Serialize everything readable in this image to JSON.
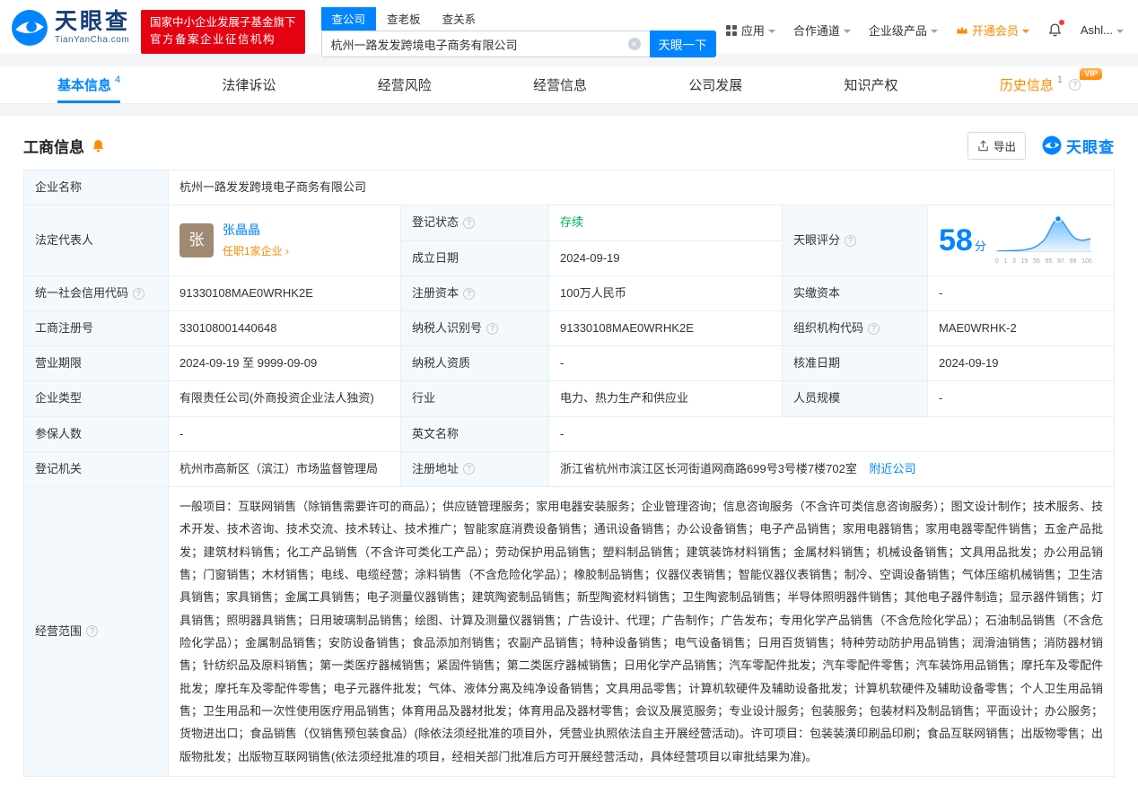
{
  "header": {
    "logo": {
      "title": "天眼查",
      "subtitle": "TianYanCha.com"
    },
    "badge": {
      "line1": "国家中小企业发展子基金旗下",
      "line2": "官方备案企业征信机构"
    },
    "search": {
      "tabs": [
        {
          "label": "查公司"
        },
        {
          "label": "查老板"
        },
        {
          "label": "查关系"
        }
      ],
      "value": "杭州一路发发跨境电子商务有限公司",
      "button": "天眼一下"
    },
    "nav": {
      "apps": "应用",
      "cooperation": "合作通道",
      "enterprise": "企业级产品",
      "vip": "开通会员",
      "user": "Ashl..."
    }
  },
  "tabs": {
    "items": [
      {
        "label": "基本信息",
        "count": "4"
      },
      {
        "label": "法律诉讼"
      },
      {
        "label": "经营风险"
      },
      {
        "label": "经营信息"
      },
      {
        "label": "公司发展"
      },
      {
        "label": "知识产权"
      },
      {
        "label": "历史信息",
        "count": "1",
        "badge": "VIP"
      }
    ]
  },
  "section": {
    "title": "工商信息",
    "export_label": "导出",
    "brand": "天眼查"
  },
  "company": {
    "name_label": "企业名称",
    "name": "杭州一路发发跨境电子商务有限公司",
    "legal_label": "法定代表人",
    "legal_avatar": "张",
    "legal_name": "张晶晶",
    "legal_roles": "任职1家企业 ›",
    "status_label": "登记状态",
    "status": "存续",
    "est_label": "成立日期",
    "est_date": "2024-09-19",
    "score_label": "天眼评分",
    "score": "58",
    "score_unit": "分",
    "credit_label": "统一社会信用代码",
    "credit_code": "91330108MAE0WRHK2E",
    "capital_label": "注册资本",
    "capital": "100万人民币",
    "paid_label": "实缴资本",
    "paid": "-",
    "regno_label": "工商注册号",
    "regno": "330108001440648",
    "taxno_label": "纳税人识别号",
    "taxno": "91330108MAE0WRHK2E",
    "orgcode_label": "组织机构代码",
    "orgcode": "MAE0WRHK-2",
    "term_label": "营业期限",
    "term": "2024-09-19 至 9999-09-09",
    "taxq_label": "纳税人资质",
    "taxq": "-",
    "approve_label": "核准日期",
    "approve_date": "2024-09-19",
    "type_label": "企业类型",
    "type": "有限责任公司(外商投资企业法人独资)",
    "industry_label": "行业",
    "industry": "电力、热力生产和供应业",
    "staff_label": "人员规模",
    "staff": "-",
    "insured_label": "参保人数",
    "insured": "-",
    "en_label": "英文名称",
    "en_name": "-",
    "authority_label": "登记机关",
    "authority": "杭州市高新区（滨江）市场监督管理局",
    "address_label": "注册地址",
    "address": "浙江省杭州市滨江区长河街道网商路699号3号楼7楼702室",
    "address_link": "附近公司",
    "scope_label": "经营范围",
    "scope": "一般项目：互联网销售（除销售需要许可的商品）；供应链管理服务；家用电器安装服务；企业管理咨询；信息咨询服务（不含许可类信息咨询服务）；图文设计制作；技术服务、技术开发、技术咨询、技术交流、技术转让、技术推广；智能家庭消费设备销售；通讯设备销售；办公设备销售；电子产品销售；家用电器销售；家用电器零配件销售；五金产品批发；建筑材料销售；化工产品销售（不含许可类化工产品）；劳动保护用品销售；塑料制品销售；建筑装饰材料销售；金属材料销售；机械设备销售；文具用品批发；办公用品销售；门窗销售；木材销售；电线、电缆经营；涂料销售（不含危险化学品）；橡胶制品销售；仪器仪表销售；智能仪器仪表销售；制冷、空调设备销售；气体压缩机械销售；卫生洁具销售；家具销售；金属工具销售；电子测量仪器销售；建筑陶瓷制品销售；新型陶瓷材料销售；卫生陶瓷制品销售；半导体照明器件销售；其他电子器件制造；显示器件销售；灯具销售；照明器具销售；日用玻璃制品销售；绘图、计算及测量仪器销售；广告设计、代理；广告制作；广告发布；专用化学产品销售（不含危险化学品）；石油制品销售（不含危险化学品）；金属制品销售；安防设备销售；食品添加剂销售；农副产品销售；特种设备销售；电气设备销售；日用百货销售；特种劳动防护用品销售；润滑油销售；消防器材销售；针纺织品及原料销售；第一类医疗器械销售；紧固件销售；第二类医疗器械销售；日用化学产品销售；汽车零配件批发；汽车零配件零售；汽车装饰用品销售；摩托车及零配件批发；摩托车及零配件零售；电子元器件批发；气体、液体分离及纯净设备销售；文具用品零售；计算机软硬件及辅助设备批发；计算机软硬件及辅助设备零售；个人卫生用品销售；卫生用品和一次性使用医疗用品销售；体育用品及器材批发；体育用品及器材零售；会议及展览服务；专业设计服务；包装服务；包装材料及制品销售；平面设计；办公服务；货物进出口；食品销售（仅销售预包装食品）(除依法须经批准的项目外，凭营业执照依法自主开展经营活动)。许可项目：包装装潢印刷品印刷；食品互联网销售；出版物零售；出版物批发；出版物互联网销售(依法须经批准的项目，经相关部门批准后方可开展经营活动，具体经营项目以审批结果为准)。"
  },
  "score_chart": {
    "ticks": [
      "0",
      "1",
      "3",
      "15",
      "55",
      "65",
      "97",
      "99",
      "100"
    ]
  }
}
